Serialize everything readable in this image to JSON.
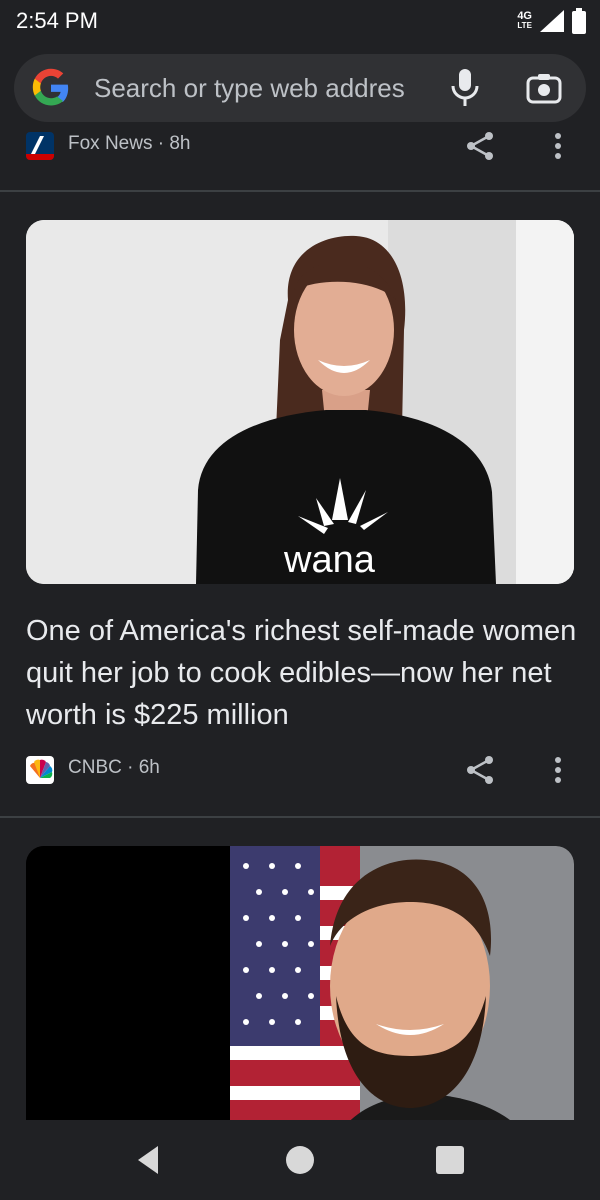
{
  "status_bar": {
    "time": "2:54 PM",
    "network_label": "4G",
    "network_sub": "LTE"
  },
  "search": {
    "placeholder": "Search or type web addres"
  },
  "feed": {
    "items": [
      {
        "source": "Fox News",
        "age": "8h",
        "meta": "Fox News · 8h"
      },
      {
        "headline": "One of America's richest self-made women quit her job to cook edibles—now her net worth is $225 million",
        "source": "CNBC",
        "age": "6h",
        "meta": "CNBC · 6h",
        "image_shirt_text": "wana"
      }
    ]
  },
  "colors": {
    "background": "#202124",
    "surface": "#303134",
    "text_primary": "#e8eaed",
    "text_secondary": "#bdc1c6"
  }
}
